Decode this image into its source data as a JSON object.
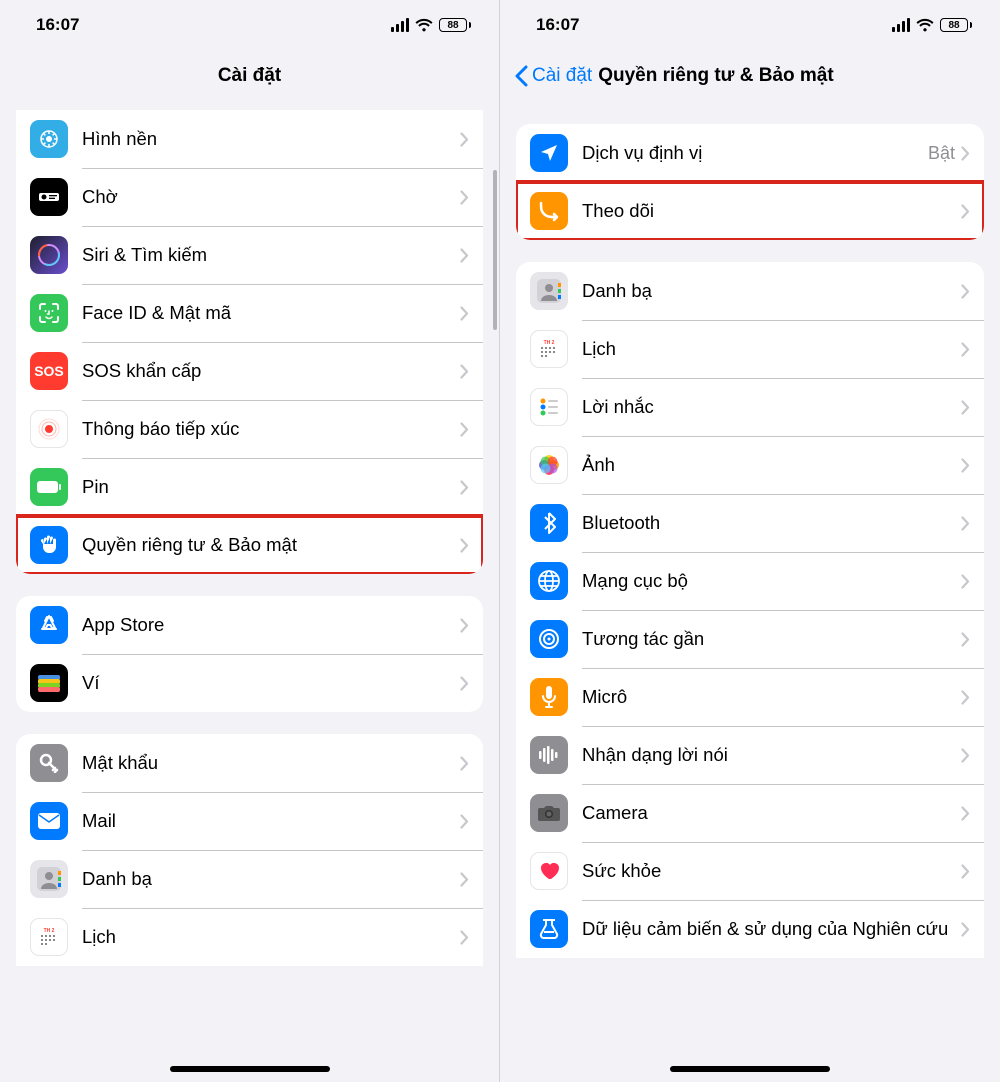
{
  "status": {
    "time": "16:07",
    "battery": "88"
  },
  "left": {
    "title": "Cài đặt",
    "groups": [
      {
        "partialTop": true,
        "cutTop": true,
        "rows": [
          {
            "icon": "wallpaper",
            "label": "Hình nền",
            "bg": "bg-cyan"
          },
          {
            "icon": "standby",
            "label": "Chờ",
            "bg": "bg-black"
          },
          {
            "icon": "siri",
            "label": "Siri & Tìm kiếm",
            "bg": "bg-purple-grad"
          },
          {
            "icon": "faceid",
            "label": "Face ID & Mật mã",
            "bg": "bg-green"
          },
          {
            "icon": "sos",
            "label": "SOS khẩn cấp",
            "bg": "bg-red"
          },
          {
            "icon": "exposure",
            "label": "Thông báo tiếp xúc",
            "bg": "bg-white"
          },
          {
            "icon": "battery",
            "label": "Pin",
            "bg": "bg-green"
          },
          {
            "icon": "privacy",
            "label": "Quyền riêng tư & Bảo mật",
            "bg": "bg-blue",
            "highlight": true
          }
        ]
      },
      {
        "rows": [
          {
            "icon": "appstore",
            "label": "App Store",
            "bg": "bg-blue"
          },
          {
            "icon": "wallet",
            "label": "Ví",
            "bg": "bg-black"
          }
        ]
      },
      {
        "cutBottom": true,
        "rows": [
          {
            "icon": "passwords",
            "label": "Mật khẩu",
            "bg": "bg-gray"
          },
          {
            "icon": "mail",
            "label": "Mail",
            "bg": "bg-blue"
          },
          {
            "icon": "contacts",
            "label": "Danh bạ",
            "bg": "bg-lgray"
          },
          {
            "icon": "calendar",
            "label": "Lịch",
            "bg": "bg-white"
          }
        ]
      }
    ]
  },
  "right": {
    "back": "Cài đặt",
    "title": "Quyền riêng tư & Bảo mật",
    "groups": [
      {
        "rows": [
          {
            "icon": "location",
            "label": "Dịch vụ định vị",
            "value": "Bật",
            "bg": "bg-blue"
          },
          {
            "icon": "tracking",
            "label": "Theo dõi",
            "bg": "bg-orange",
            "highlight": true
          }
        ]
      },
      {
        "cutBottom": true,
        "rows": [
          {
            "icon": "contacts",
            "label": "Danh bạ",
            "bg": "bg-lgray"
          },
          {
            "icon": "calendar",
            "label": "Lịch",
            "bg": "bg-white"
          },
          {
            "icon": "reminders",
            "label": "Lời nhắc",
            "bg": "bg-white"
          },
          {
            "icon": "photos",
            "label": "Ảnh",
            "bg": "bg-white"
          },
          {
            "icon": "bluetooth",
            "label": "Bluetooth",
            "bg": "bg-blue"
          },
          {
            "icon": "localnet",
            "label": "Mạng cục bộ",
            "bg": "bg-blue"
          },
          {
            "icon": "nearby",
            "label": "Tương tác gần",
            "bg": "bg-blue"
          },
          {
            "icon": "mic",
            "label": "Micrô",
            "bg": "bg-orange"
          },
          {
            "icon": "speech",
            "label": "Nhận dạng lời nói",
            "bg": "bg-gray"
          },
          {
            "icon": "camera",
            "label": "Camera",
            "bg": "bg-gray"
          },
          {
            "icon": "health",
            "label": "Sức khỏe",
            "bg": "bg-white"
          },
          {
            "icon": "research",
            "label": "Dữ liệu cảm biến & sử dụng của Nghiên cứu",
            "bg": "bg-blue"
          }
        ]
      }
    ]
  }
}
